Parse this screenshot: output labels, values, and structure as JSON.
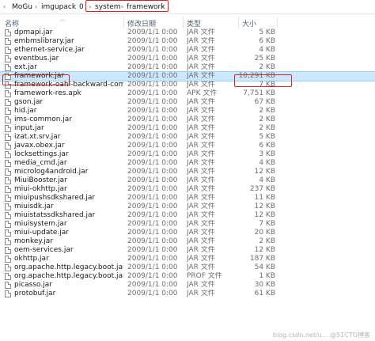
{
  "breadcrumb": {
    "items": [
      "MoGu",
      "imgupack",
      "0",
      "system",
      "framework"
    ],
    "separator": "›"
  },
  "columns": {
    "name": "名称",
    "date": "修改日期",
    "type": "类型",
    "size": "大小"
  },
  "files": [
    {
      "name": "dpmapi.jar",
      "date": "2009/1/1 0:00",
      "type": "JAR 文件",
      "size": "5 KB"
    },
    {
      "name": "embmslibrary.jar",
      "date": "2009/1/1 0:00",
      "type": "JAR 文件",
      "size": "6 KB"
    },
    {
      "name": "ethernet-service.jar",
      "date": "2009/1/1 0:00",
      "type": "JAR 文件",
      "size": "4 KB"
    },
    {
      "name": "eventbus.jar",
      "date": "2009/1/1 0:00",
      "type": "JAR 文件",
      "size": "25 KB"
    },
    {
      "name": "ext.jar",
      "date": "2009/1/1 0:00",
      "type": "JAR 文件",
      "size": "2 KB"
    },
    {
      "name": "framework.jar",
      "date": "2009/1/1 0:00",
      "type": "JAR 文件",
      "size": "10,291 KB"
    },
    {
      "name": "framework-oahl-backward-compatib...",
      "date": "2009/1/1 0:00",
      "type": "JAR 文件",
      "size": "7 KB"
    },
    {
      "name": "framework-res.apk",
      "date": "2009/1/1 0:00",
      "type": "APK 文件",
      "size": "7,751 KB"
    },
    {
      "name": "gson.jar",
      "date": "2009/1/1 0:00",
      "type": "JAR 文件",
      "size": "67 KB"
    },
    {
      "name": "hid.jar",
      "date": "2009/1/1 0:00",
      "type": "JAR 文件",
      "size": "2 KB"
    },
    {
      "name": "ims-common.jar",
      "date": "2009/1/1 0:00",
      "type": "JAR 文件",
      "size": "2 KB"
    },
    {
      "name": "input.jar",
      "date": "2009/1/1 0:00",
      "type": "JAR 文件",
      "size": "2 KB"
    },
    {
      "name": "izat.xt.srv.jar",
      "date": "2009/1/1 0:00",
      "type": "JAR 文件",
      "size": "5 KB"
    },
    {
      "name": "javax.obex.jar",
      "date": "2009/1/1 0:00",
      "type": "JAR 文件",
      "size": "6 KB"
    },
    {
      "name": "locksettings.jar",
      "date": "2009/1/1 0:00",
      "type": "JAR 文件",
      "size": "3 KB"
    },
    {
      "name": "media_cmd.jar",
      "date": "2009/1/1 0:00",
      "type": "JAR 文件",
      "size": "4 KB"
    },
    {
      "name": "microlog4android.jar",
      "date": "2009/1/1 0:00",
      "type": "JAR 文件",
      "size": "12 KB"
    },
    {
      "name": "MiuiBooster.jar",
      "date": "2009/1/1 0:00",
      "type": "JAR 文件",
      "size": "4 KB"
    },
    {
      "name": "miui-okhttp.jar",
      "date": "2009/1/1 0:00",
      "type": "JAR 文件",
      "size": "237 KB"
    },
    {
      "name": "miuipushsdkshared.jar",
      "date": "2009/1/1 0:00",
      "type": "JAR 文件",
      "size": "11 KB"
    },
    {
      "name": "miuisdk.jar",
      "date": "2009/1/1 0:00",
      "type": "JAR 文件",
      "size": "12 KB"
    },
    {
      "name": "miuistatssdkshared.jar",
      "date": "2009/1/1 0:00",
      "type": "JAR 文件",
      "size": "12 KB"
    },
    {
      "name": "miuisystem.jar",
      "date": "2009/1/1 0:00",
      "type": "JAR 文件",
      "size": "7 KB"
    },
    {
      "name": "miui-update.jar",
      "date": "2009/1/1 0:00",
      "type": "JAR 文件",
      "size": "20 KB"
    },
    {
      "name": "monkey.jar",
      "date": "2009/1/1 0:00",
      "type": "JAR 文件",
      "size": "2 KB"
    },
    {
      "name": "oem-services.jar",
      "date": "2009/1/1 0:00",
      "type": "JAR 文件",
      "size": "12 KB"
    },
    {
      "name": "okhttp.jar",
      "date": "2009/1/1 0:00",
      "type": "JAR 文件",
      "size": "187 KB"
    },
    {
      "name": "org.apache.http.legacy.boot.jar",
      "date": "2009/1/1 0:00",
      "type": "JAR 文件",
      "size": "54 KB"
    },
    {
      "name": "org.apache.http.legacy.boot.jar.prof",
      "date": "2009/1/1 0:00",
      "type": "PROF 文件",
      "size": "1 KB"
    },
    {
      "name": "picasso.jar",
      "date": "2009/1/1 0:00",
      "type": "JAR 文件",
      "size": "30 KB"
    },
    {
      "name": "protobuf.jar",
      "date": "2009/1/1 0:00",
      "type": "JAR 文件",
      "size": "61 KB"
    }
  ],
  "selected_file": "framework.jar",
  "highlight_color": "#e02020",
  "file_icon": "document-icon",
  "watermark": "blog.csdn.net/u... @51CTO搏客"
}
